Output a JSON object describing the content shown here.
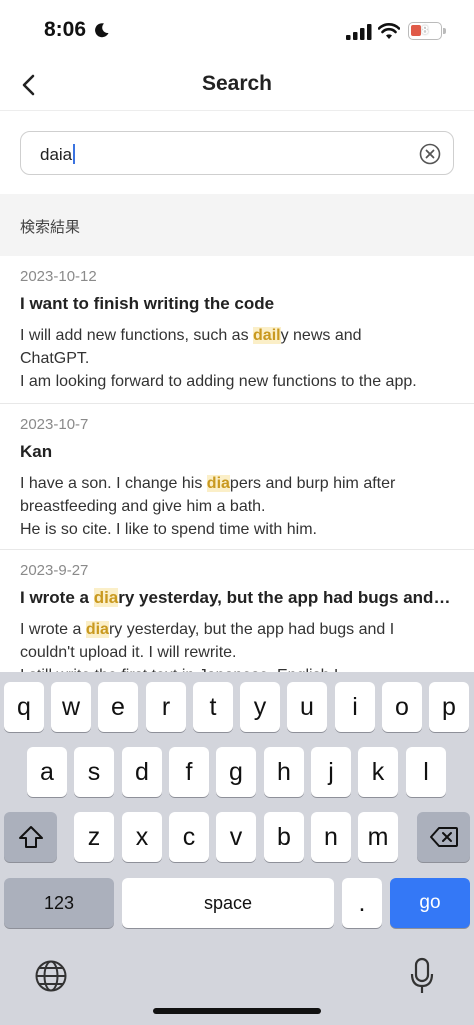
{
  "status": {
    "time": "8:06",
    "battery": "8"
  },
  "nav": {
    "title": "Search"
  },
  "search": {
    "value": "daia"
  },
  "section": {
    "label": "検索結果"
  },
  "results": [
    {
      "date": "2023-10-12",
      "title": "I want to finish writing the code",
      "line1_pre": "I will add new functions, such as ",
      "line1_hl": "dail",
      "line1_post": "y news and",
      "line2": "ChatGPT.",
      "line3": "I am looking forward to adding new functions to the app."
    },
    {
      "date": "2023-10-7",
      "title": "Kan",
      "line1_pre": "I have a son. I change his ",
      "line1_hl": "dia",
      "line1_post": "pers and burp him after",
      "line2": "breastfeeding and give him a bath.",
      "line3": "He is so cite. I like to spend time with him."
    },
    {
      "date": "2023-9-27",
      "title_pre": "I wrote a ",
      "title_hl": "dia",
      "title_post": "ry yesterday, but the app had bugs and I couldn't upload it.",
      "line1_pre": "I wrote a ",
      "line1_hl": "dia",
      "line1_post": "ry yesterday, but the app had bugs and I",
      "line2": "couldn't upload it. I will rewrite.",
      "line3": "I still write the first text in Japanese. English I"
    }
  ],
  "keyboard": {
    "row1": [
      "q",
      "w",
      "e",
      "r",
      "t",
      "y",
      "u",
      "i",
      "o",
      "p"
    ],
    "row2": [
      "a",
      "s",
      "d",
      "f",
      "g",
      "h",
      "j",
      "k",
      "l"
    ],
    "row3": [
      "z",
      "x",
      "c",
      "v",
      "b",
      "n",
      "m"
    ],
    "numbers": "123",
    "space": "space",
    "period": ".",
    "go": "go"
  },
  "colors": {
    "accent": "#3478f6",
    "highlight_text": "#c9991f",
    "highlight_bg": "#fbefc8"
  }
}
